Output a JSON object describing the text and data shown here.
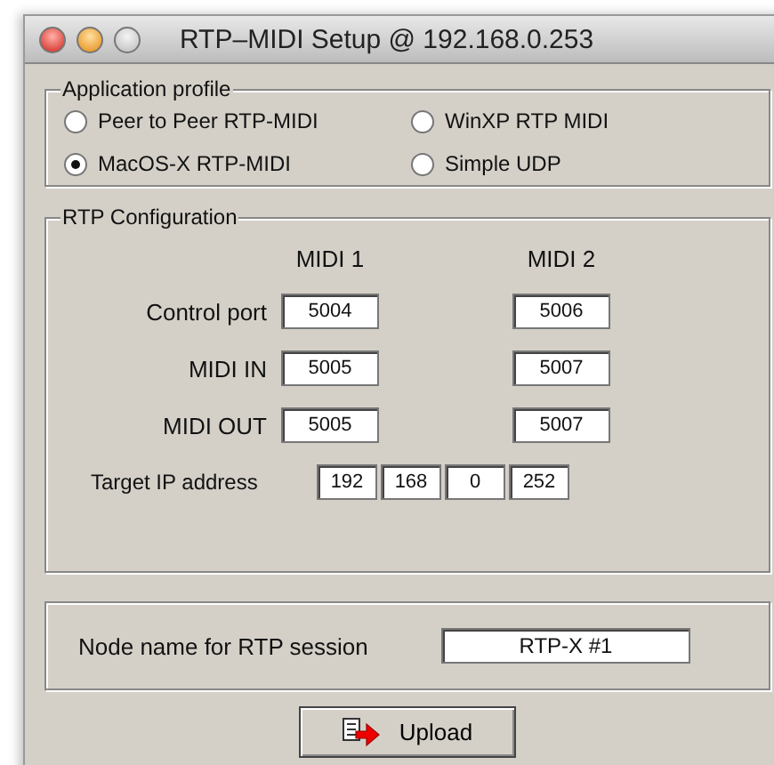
{
  "window": {
    "title": "RTP–MIDI Setup @ 192.168.0.253"
  },
  "profile": {
    "legend": "Application profile",
    "options": [
      {
        "label": "Peer to Peer RTP-MIDI",
        "selected": false
      },
      {
        "label": "WinXP RTP MIDI",
        "selected": false
      },
      {
        "label": "MacOS-X RTP-MIDI",
        "selected": true
      },
      {
        "label": "Simple UDP",
        "selected": false
      }
    ]
  },
  "rtp": {
    "legend": "RTP Configuration",
    "columns": [
      "MIDI 1",
      "MIDI 2"
    ],
    "rows": [
      {
        "label": "Control port",
        "values": [
          "5004",
          "5006"
        ]
      },
      {
        "label": "MIDI IN",
        "values": [
          "5005",
          "5007"
        ]
      },
      {
        "label": "MIDI OUT",
        "values": [
          "5005",
          "5007"
        ]
      }
    ],
    "ip_label": "Target IP address",
    "ip": [
      "192",
      "168",
      "0",
      "252"
    ]
  },
  "node": {
    "label": "Node name for RTP session",
    "value": "RTP-X #1"
  },
  "upload_button": "Upload"
}
